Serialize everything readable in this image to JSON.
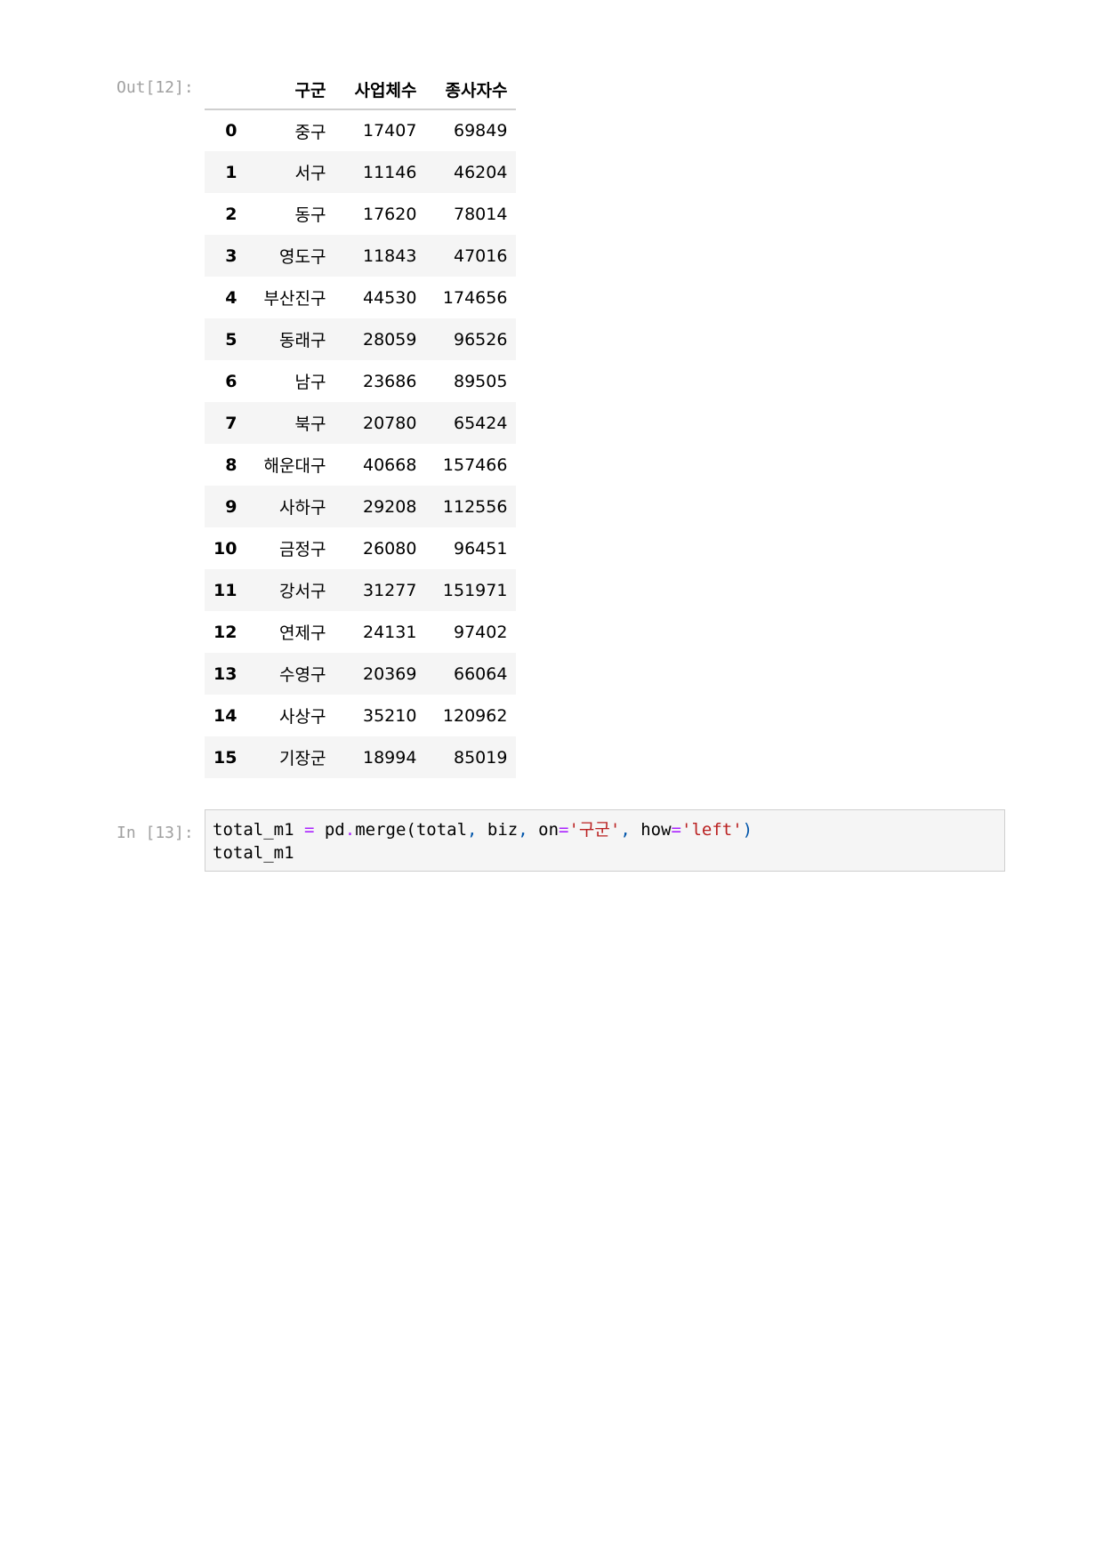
{
  "output_prompt": "Out[12]:",
  "input_prompt": "In [13]:",
  "table": {
    "columns": [
      "",
      "구군",
      "사업체수",
      "종사자수"
    ],
    "rows": [
      {
        "index": "0",
        "gu": "중구",
        "biz": "17407",
        "emp": "69849"
      },
      {
        "index": "1",
        "gu": "서구",
        "biz": "11146",
        "emp": "46204"
      },
      {
        "index": "2",
        "gu": "동구",
        "biz": "17620",
        "emp": "78014"
      },
      {
        "index": "3",
        "gu": "영도구",
        "biz": "11843",
        "emp": "47016"
      },
      {
        "index": "4",
        "gu": "부산진구",
        "biz": "44530",
        "emp": "174656"
      },
      {
        "index": "5",
        "gu": "동래구",
        "biz": "28059",
        "emp": "96526"
      },
      {
        "index": "6",
        "gu": "남구",
        "biz": "23686",
        "emp": "89505"
      },
      {
        "index": "7",
        "gu": "북구",
        "biz": "20780",
        "emp": "65424"
      },
      {
        "index": "8",
        "gu": "해운대구",
        "biz": "40668",
        "emp": "157466"
      },
      {
        "index": "9",
        "gu": "사하구",
        "biz": "29208",
        "emp": "112556"
      },
      {
        "index": "10",
        "gu": "금정구",
        "biz": "26080",
        "emp": "96451"
      },
      {
        "index": "11",
        "gu": "강서구",
        "biz": "31277",
        "emp": "151971"
      },
      {
        "index": "12",
        "gu": "연제구",
        "biz": "24131",
        "emp": "97402"
      },
      {
        "index": "13",
        "gu": "수영구",
        "biz": "20369",
        "emp": "66064"
      },
      {
        "index": "14",
        "gu": "사상구",
        "biz": "35210",
        "emp": "120962"
      },
      {
        "index": "15",
        "gu": "기장군",
        "biz": "18994",
        "emp": "85019"
      }
    ]
  },
  "code": {
    "line1": {
      "var": "total_m1 ",
      "eq": "=",
      "call": " pd",
      "dot": ".",
      "fn": "merge(total",
      "comma1": ",",
      "arg2": " biz",
      "comma2": ",",
      "kw1": " on",
      "eq2": "=",
      "str1": "'구군'",
      "comma3": ",",
      "kw2": " how",
      "eq3": "=",
      "str2": "'left'",
      "close": ")"
    },
    "line2": "total_m1"
  },
  "colors": {
    "prompt": "#a0a0a0",
    "operator": "#aa22ff",
    "string": "#ba2121",
    "code_bg": "#f5f5f5",
    "row_stripe": "#f5f5f5"
  }
}
